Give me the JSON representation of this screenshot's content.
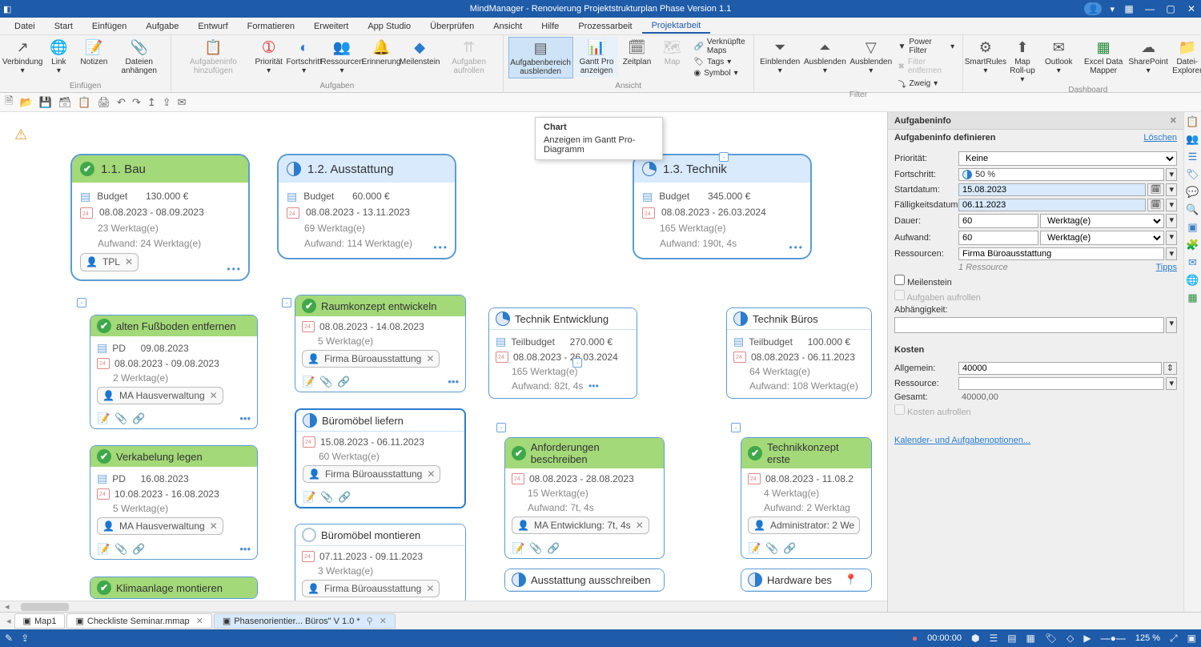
{
  "app": {
    "title": "MindManager - Renovierung Projektstrukturplan Phase Version 1.1"
  },
  "menu": {
    "items": [
      "Datei",
      "Start",
      "Einfügen",
      "Aufgabe",
      "Entwurf",
      "Formatieren",
      "Erweitert",
      "App Studio",
      "Überprüfen",
      "Ansicht",
      "Hilfe",
      "Prozessarbeit",
      "Projektarbeit"
    ],
    "active": 12
  },
  "ribbon": {
    "groups": {
      "einfuegen": {
        "name": "Einfügen",
        "verbindung": "Verbindung",
        "link": "Link",
        "notizen": "Notizen",
        "dateien": "Dateien anhängen"
      },
      "aufgaben": {
        "name": "Aufgaben",
        "aufgabeninfo": "Aufgabeninfo hinzufügen",
        "prioritaet": "Priorität",
        "fortschritt": "Fortschritt",
        "ressourcen": "Ressourcen",
        "erinnerung": "Erinnerung",
        "meilenstein": "Meilenstein",
        "aufrollen": "Aufgaben aufrollen"
      },
      "ansicht": {
        "name": "Ansicht",
        "aufgabenbereich": "Aufgabenbereich ausblenden",
        "gantt": "Gantt Pro anzeigen",
        "zeitplan": "Zeitplan",
        "map": "Map",
        "verknuepfte": "Verknüpfte Maps",
        "tags": "Tags",
        "symbol": "Symbol"
      },
      "filter": {
        "name": "Filter",
        "ein": "Einblenden",
        "aus": "Ausblenden",
        "ausbl": "Ausblenden",
        "power": "Power Filter",
        "entfernen": "Filter entfernen",
        "zweig": "Zweig"
      },
      "dashboard": {
        "name": "Dashboard",
        "smartrules": "SmartRules",
        "rollup": "Map Roll-up",
        "outlook": "Outlook",
        "excel": "Excel Data Mapper",
        "sharepoint": "SharePoint",
        "explorer": "Datei-Explorer"
      }
    }
  },
  "tooltip": {
    "title": "Chart",
    "body": "Anzeigen im Gantt Pro-Diagramm"
  },
  "nodes": {
    "bau": {
      "title": "1.1. Bau",
      "budget_lbl": "Budget",
      "budget": "130.000 €",
      "dates": "08.08.2023 - 08.09.2023",
      "werktage": "23 Werktag(e)",
      "aufwand": "Aufwand: 24 Werktag(e)",
      "tag": "TPL"
    },
    "ausstattung": {
      "title": "1.2. Ausstattung",
      "budget_lbl": "Budget",
      "budget": "60.000 €",
      "dates": "08.08.2023 - 13.11.2023",
      "werktage": "69 Werktag(e)",
      "aufwand": "Aufwand: 114 Werktag(e)"
    },
    "technik": {
      "title": "1.3. Technik",
      "budget_lbl": "Budget",
      "budget": "345.000 €",
      "dates": "08.08.2023 - 26.03.2024",
      "werktage": "165 Werktag(e)",
      "aufwand": "Aufwand: 190t, 4s"
    },
    "fussboden": {
      "title": "alten Fußboden entfernen",
      "pd": "PD",
      "pd_date": "09.08.2023",
      "dates": "08.08.2023 - 09.08.2023",
      "werk": "2 Werktag(e)",
      "res": "MA Hausverwaltung"
    },
    "verkabelung": {
      "title": "Verkabelung  legen",
      "pd": "PD",
      "pd_date": "16.08.2023",
      "dates": "10.08.2023 - 16.08.2023",
      "werk": "5 Werktag(e)",
      "res": "MA Hausverwaltung"
    },
    "klima": {
      "title": "Klimaanlage montieren"
    },
    "raumkonzept": {
      "title": "Raumkonzept entwickeln",
      "dates": "08.08.2023 - 14.08.2023",
      "werk": "5 Werktag(e)",
      "res": "Firma Büroausstattung"
    },
    "bueromoebel_liefern": {
      "title": "Büromöbel liefern",
      "dates": "15.08.2023 - 06.11.2023",
      "werk": "60 Werktag(e)",
      "res": "Firma Büroausstattung"
    },
    "bueromoebel_mont": {
      "title": "Büromöbel montieren",
      "dates": "07.11.2023 - 09.11.2023",
      "werk": "3 Werktag(e)",
      "res": "Firma Büroausstattung"
    },
    "technik_entw": {
      "title": "Technik Entwicklung",
      "teil_lbl": "Teilbudget",
      "teil": "270.000 €",
      "dates": "08.08.2023 - 26.03.2024",
      "werk": "165 Werktag(e)",
      "aufw": "Aufwand: 82t, 4s"
    },
    "technik_bueros": {
      "title": "Technik Büros",
      "teil_lbl": "Teilbudget",
      "teil": "100.000 €",
      "dates": "08.08.2023 - 06.11.2023",
      "werk": "64 Werktag(e)",
      "aufw": "Aufwand: 108 Werktag(e)"
    },
    "anforderungen": {
      "title": "Anforderungen beschreiben",
      "dates": "08.08.2023 - 28.08.2023",
      "werk": "15 Werktag(e)",
      "aufw": "Aufwand: 7t, 4s",
      "res": "MA Entwicklung: 7t, 4s"
    },
    "technikkonzept": {
      "title": "Technikkonzept erste",
      "dates": "08.08.2023 - 11.08.2",
      "werk": "4 Werktag(e)",
      "aufw": "Aufwand: 2 Werktag",
      "res": "Administrator: 2 We"
    },
    "ausstattung_aus": {
      "title": "Ausstattung ausschreiben"
    },
    "hardware": {
      "title": "Hardware bes"
    }
  },
  "panel": {
    "title": "Aufgabeninfo",
    "definieren": "Aufgabeninfo definieren",
    "loeschen": "Löschen",
    "prioritaet_lbl": "Priorität:",
    "prioritaet_val": "Keine",
    "fortschritt_lbl": "Fortschritt:",
    "fortschritt_val": "50 %",
    "start_lbl": "Startdatum:",
    "start_val": "15.08.2023",
    "faellig_lbl": "Fälligkeitsdatum:",
    "faellig_val": "06.11.2023",
    "dauer_lbl": "Dauer:",
    "dauer_val": "60",
    "dauer_unit": "Werktag(e)",
    "aufwand_lbl": "Aufwand:",
    "aufwand_val": "60",
    "aufwand_unit": "Werktag(e)",
    "ress_lbl": "Ressourcen:",
    "ress_val": "Firma Büroausstattung",
    "ress_hint": "1 Ressource",
    "tipps": "Tipps",
    "meilenstein": "Meilenstein",
    "aufrollen": "Aufgaben aufrollen",
    "abhaengig": "Abhängigkeit:",
    "kosten_title": "Kosten",
    "allgemein_lbl": "Allgemein:",
    "allgemein_val": "40000",
    "ressource_lbl": "Ressource:",
    "gesamt_lbl": "Gesamt:",
    "gesamt_val": "40000,00",
    "kosten_aufrollen": "Kosten aufrollen",
    "kalender_link": "Kalender- und Aufgabenoptionen..."
  },
  "tabs": {
    "map1": "Map1",
    "checkliste": "Checkliste Seminar.mmap",
    "phasen": "Phasenorientier... Büros\" V 1.0 *"
  },
  "status": {
    "time": "00:00:00",
    "zoom": "125 %"
  }
}
